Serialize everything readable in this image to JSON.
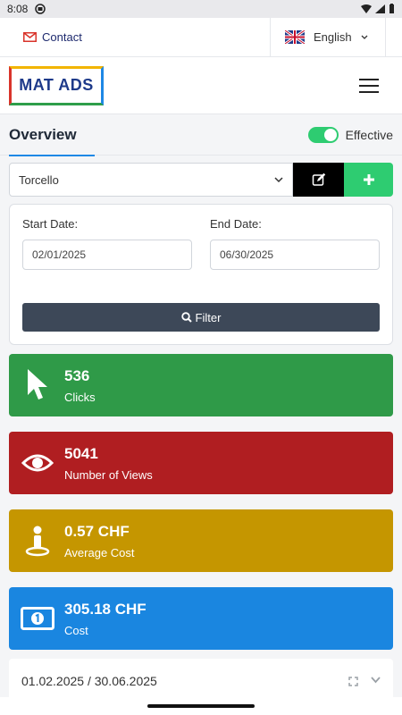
{
  "statusbar": {
    "time": "8:08"
  },
  "topbar": {
    "contact_label": "Contact",
    "language": "English"
  },
  "header": {
    "logo_text": "MAT ADS"
  },
  "overview": {
    "tab_label": "Overview",
    "toggle_label": "Effective",
    "toggle_on": true
  },
  "campaign_select": {
    "value": "Torcello"
  },
  "filter": {
    "start_label": "Start Date:",
    "start_value": "02/01/2025",
    "end_label": "End Date:",
    "end_value": "06/30/2025",
    "button_label": "Filter"
  },
  "stats": [
    {
      "value": "536",
      "label": "Clicks",
      "icon": "cursor-icon",
      "color": "#2f9a48"
    },
    {
      "value": "5041",
      "label": "Number of Views",
      "icon": "eye-icon",
      "color": "#b01e21"
    },
    {
      "value": "0.57 CHF",
      "label": "Average Cost",
      "icon": "person-pin-icon",
      "color": "#c59600"
    },
    {
      "value": "305.18 CHF",
      "label": "Cost",
      "icon": "money-icon",
      "color": "#1a86e0"
    }
  ],
  "range_card": {
    "text": "01.02.2025 / 30.06.2025"
  }
}
